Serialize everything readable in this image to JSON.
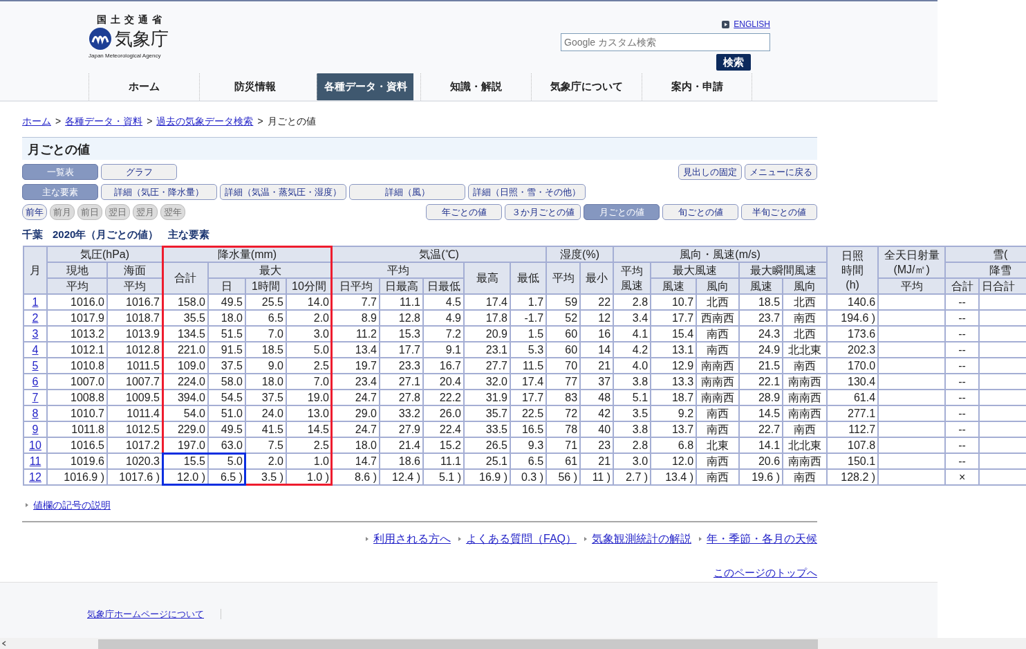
{
  "header": {
    "ministry": "国 土 交 通 省",
    "agency": "気象庁",
    "agency_en": "Japan Meteorological Agency",
    "english_link": "ENGLISH",
    "search": {
      "placeholder": "Google カスタム検索"
    },
    "search_button": "検索"
  },
  "nav": [
    {
      "label": "ホーム",
      "selected": false
    },
    {
      "label": "防災情報",
      "selected": false
    },
    {
      "label": "各種データ・資料",
      "selected": true
    },
    {
      "label": "知識・解説",
      "selected": false
    },
    {
      "label": "気象庁について",
      "selected": false
    },
    {
      "label": "案内・申請",
      "selected": false
    }
  ],
  "breadcrumb": {
    "separator": ">",
    "items": [
      {
        "label": "ホーム",
        "link": true
      },
      {
        "label": "各種データ・資料",
        "link": true
      },
      {
        "label": "過去の気象データ検索",
        "link": true
      },
      {
        "label": "月ごとの値",
        "link": false
      }
    ]
  },
  "page_title": "月ごとの値",
  "view_buttons": [
    {
      "label": "一覧表",
      "selected": true
    },
    {
      "label": "グラフ",
      "selected": false
    }
  ],
  "right_buttons": [
    "見出しの固定",
    "メニューに戻る"
  ],
  "element_buttons": [
    {
      "label": "主な要素",
      "selected": true
    },
    {
      "label": "詳細（気圧・降水量）",
      "selected": false
    },
    {
      "label": "詳細（気温・蒸気圧・湿度）",
      "selected": false
    },
    {
      "label": "詳細（風）",
      "selected": false
    },
    {
      "label": "詳細（日照・雪・その他）",
      "selected": false
    }
  ],
  "step_buttons": [
    {
      "label": "前年",
      "disabled": false
    },
    {
      "label": "前月",
      "disabled": true
    },
    {
      "label": "前日",
      "disabled": true
    },
    {
      "label": "翌日",
      "disabled": true
    },
    {
      "label": "翌月",
      "disabled": true
    },
    {
      "label": "翌年",
      "disabled": true
    }
  ],
  "period_buttons": [
    {
      "label": "年ごとの値",
      "selected": false
    },
    {
      "label": "３か月ごとの値",
      "selected": false
    },
    {
      "label": "月ごとの値",
      "selected": true
    },
    {
      "label": "旬ごとの値",
      "selected": false
    },
    {
      "label": "半旬ごとの値",
      "selected": false
    }
  ],
  "table_caption": [
    "千葉",
    "2020年（月ごとの値）",
    "主な要素"
  ],
  "table": {
    "header_rows": [
      [
        "月",
        "気圧(hPa)",
        "降水量(mm)",
        "気温(℃)",
        "湿度(%)",
        "風向・風速(m/s)",
        [
          "日照",
          "時間",
          "(h)"
        ],
        [
          "全天日射量",
          "(MJ/㎡)"
        ],
        "雪("
      ],
      [
        "現地",
        "海面",
        "合計",
        "最大",
        "平均",
        "最高",
        "最低",
        "平均",
        "最小",
        [
          "平均",
          "風速"
        ],
        "最大風速",
        "最大瞬間風速",
        "降雪"
      ],
      [
        "平均",
        "平均",
        "日",
        "1時間",
        "10分間",
        "日平均",
        "日最高",
        "日最低",
        "風速",
        "風向",
        "風速",
        "風向",
        "平均",
        "合計",
        "日合計"
      ]
    ],
    "rows": [
      {
        "month": "1",
        "cells": [
          "1016.0",
          "1016.7",
          "158.0",
          "49.5",
          "25.5",
          "14.0",
          "7.7",
          "11.1",
          "4.5",
          "17.4",
          "1.7",
          "59",
          "22",
          "2.8",
          "10.7",
          "北西",
          "18.5",
          "北西",
          "140.6",
          null,
          "--",
          null
        ]
      },
      {
        "month": "2",
        "cells": [
          "1017.9",
          "1018.7",
          "35.5",
          "18.0",
          "6.5",
          "2.0",
          "8.9",
          "12.8",
          "4.9",
          "17.8",
          "-1.7",
          "52",
          "12",
          "3.4",
          "17.7",
          "西南西",
          "23.7",
          "南西",
          "194.6 )",
          null,
          "--",
          null
        ]
      },
      {
        "month": "3",
        "cells": [
          "1013.2",
          "1013.9",
          "134.5",
          "51.5",
          "7.0",
          "3.0",
          "11.2",
          "15.3",
          "7.2",
          "20.9",
          "1.5",
          "60",
          "16",
          "4.1",
          "15.4",
          "南西",
          "24.3",
          "北西",
          "173.6",
          null,
          "--",
          null
        ]
      },
      {
        "month": "4",
        "cells": [
          "1012.1",
          "1012.8",
          "221.0",
          "91.5",
          "18.5",
          "5.0",
          "13.4",
          "17.7",
          "9.1",
          "23.1",
          "5.3",
          "60",
          "14",
          "4.2",
          "13.1",
          "南西",
          "24.9",
          "北北東",
          "202.3",
          null,
          "--",
          null
        ]
      },
      {
        "month": "5",
        "cells": [
          "1010.8",
          "1011.5",
          "109.0",
          "37.5",
          "9.0",
          "2.5",
          "19.7",
          "23.3",
          "16.7",
          "27.7",
          "11.5",
          "70",
          "21",
          "4.0",
          "12.9",
          "南南西",
          "21.5",
          "南西",
          "170.0",
          null,
          "--",
          null
        ]
      },
      {
        "month": "6",
        "cells": [
          "1007.0",
          "1007.7",
          "224.0",
          "58.0",
          "18.0",
          "7.0",
          "23.4",
          "27.1",
          "20.4",
          "32.0",
          "17.4",
          "77",
          "37",
          "3.8",
          "13.3",
          "南南西",
          "22.1",
          "南南西",
          "130.4",
          null,
          "--",
          null
        ]
      },
      {
        "month": "7",
        "cells": [
          "1008.8",
          "1009.5",
          "394.0",
          "54.5",
          "37.5",
          "19.0",
          "24.7",
          "27.8",
          "22.2",
          "31.9",
          "17.7",
          "83",
          "48",
          "5.1",
          "18.7",
          "南南西",
          "28.9",
          "南南西",
          "61.4",
          null,
          "--",
          null
        ]
      },
      {
        "month": "8",
        "cells": [
          "1010.7",
          "1011.4",
          "54.0",
          "51.0",
          "24.0",
          "13.0",
          "29.0",
          "33.2",
          "26.0",
          "35.7",
          "22.5",
          "72",
          "42",
          "3.5",
          "9.2",
          "南西",
          "14.5",
          "南南西",
          "277.1",
          null,
          "--",
          null
        ]
      },
      {
        "month": "9",
        "cells": [
          "1011.8",
          "1012.5",
          "229.0",
          "49.5",
          "41.5",
          "14.5",
          "24.7",
          "27.9",
          "22.4",
          "33.5",
          "16.5",
          "78",
          "40",
          "3.8",
          "13.7",
          "南西",
          "22.7",
          "南西",
          "112.7",
          null,
          "--",
          null
        ]
      },
      {
        "month": "10",
        "cells": [
          "1016.5",
          "1017.2",
          "197.0",
          "63.0",
          "7.5",
          "2.5",
          "18.0",
          "21.4",
          "15.2",
          "26.5",
          "9.3",
          "71",
          "23",
          "2.8",
          "6.8",
          "北東",
          "14.1",
          "北北東",
          "107.8",
          null,
          "--",
          null
        ]
      },
      {
        "month": "11",
        "cells": [
          "1019.6",
          "1020.3",
          "15.5",
          "5.0",
          "2.0",
          "1.0",
          "14.7",
          "18.6",
          "11.1",
          "25.1",
          "6.5",
          "61",
          "21",
          "3.0",
          "12.0",
          "南西",
          "20.6",
          "南南西",
          "150.1",
          null,
          "--",
          null
        ]
      },
      {
        "month": "12",
        "cells": [
          "1016.9 )",
          "1017.6 )",
          "12.0 )",
          "6.5 )",
          "3.5 )",
          "1.0 )",
          "8.6 )",
          "12.4 )",
          "5.1 )",
          "16.9 )",
          "0.3 )",
          "56 )",
          "11 )",
          "2.7 )",
          "13.4 )",
          "南西",
          "19.6 )",
          "南西",
          "128.2 )",
          null,
          "×",
          null
        ]
      }
    ],
    "highlight_boxes": [
      {
        "color": "#ee1c2e"
      },
      {
        "color": "#0a2ee0"
      }
    ]
  },
  "notes_link": "値欄の記号の説明",
  "footer_links": [
    "利用される方へ",
    "よくある質問（FAQ）",
    "気象観測統計の解説",
    "年・季節・各月の天候"
  ],
  "top_link": "このページのトップへ",
  "site_footer_link": "気象庁ホームページについて"
}
